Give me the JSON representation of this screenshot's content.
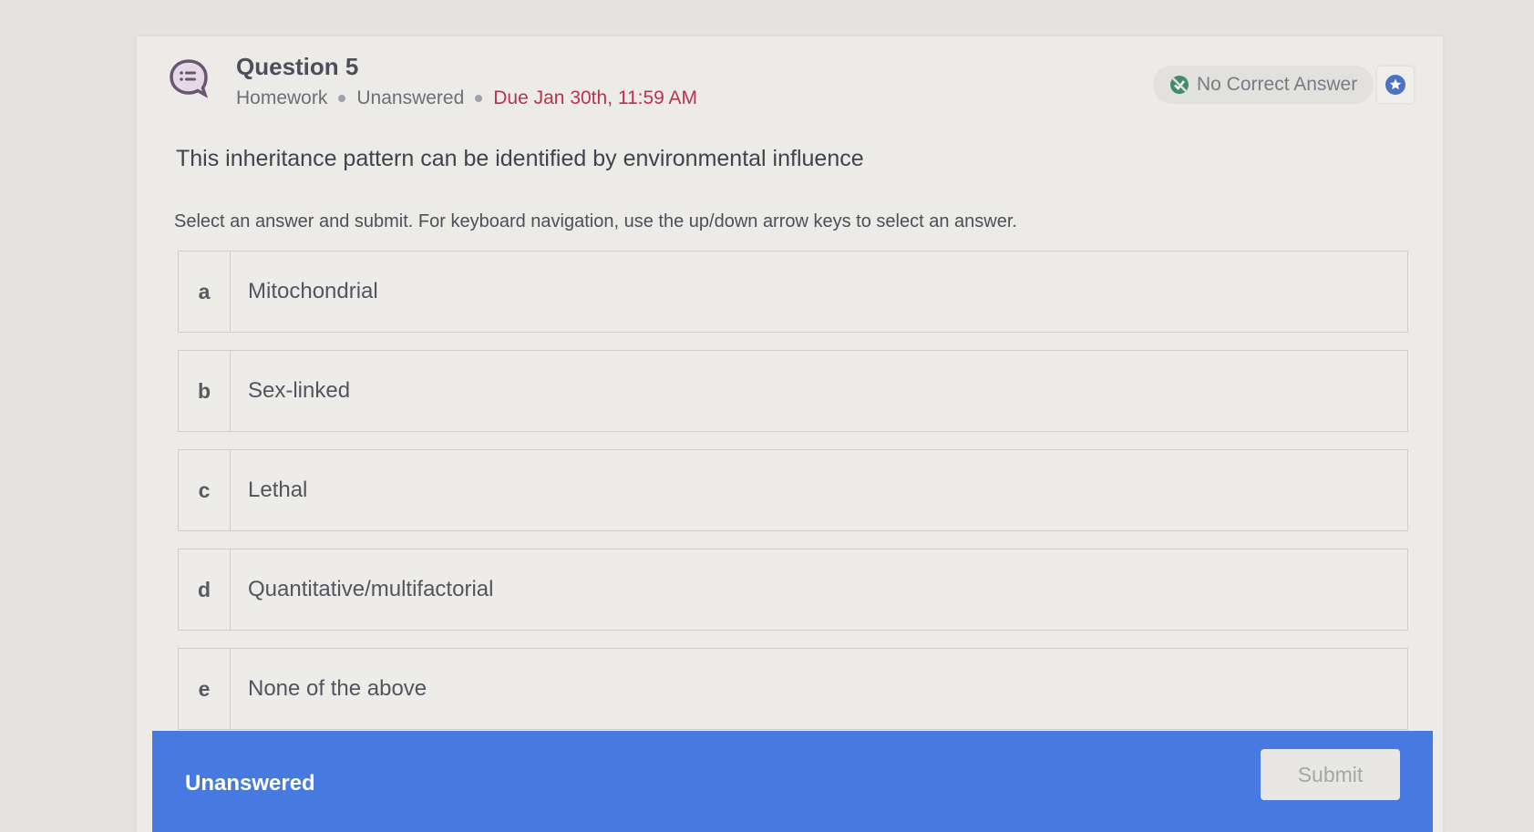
{
  "question": {
    "title": "Question 5",
    "type": "Homework",
    "status": "Unanswered",
    "due": "Due Jan 30th, 11:59 AM",
    "badge": "No Correct Answer",
    "prompt": "This inheritance pattern can be identified by environmental influence",
    "instructions": "Select an answer and submit. For keyboard navigation, use the up/down arrow keys to select an answer.",
    "options": [
      {
        "letter": "a",
        "text": "Mitochondrial"
      },
      {
        "letter": "b",
        "text": "Sex-linked"
      },
      {
        "letter": "c",
        "text": "Lethal"
      },
      {
        "letter": "d",
        "text": "Quantitative/multifactorial"
      },
      {
        "letter": "e",
        "text": "None of the above"
      }
    ]
  },
  "footer": {
    "status": "Unanswered",
    "submit_label": "Submit"
  },
  "colors": {
    "accent": "#477ae0",
    "due": "#b8334f",
    "badge_icon": "#3f8b74",
    "question_icon": "#6a5470"
  }
}
